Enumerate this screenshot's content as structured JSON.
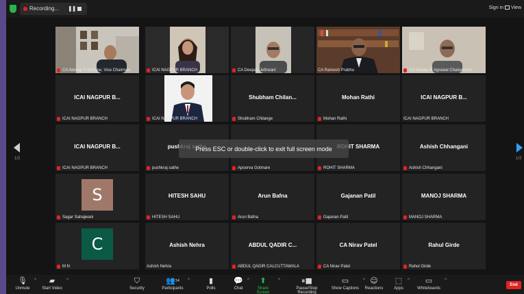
{
  "topbar": {
    "recording_label": "Recording...",
    "pause_glyph": "❚❚",
    "signin_label": "Sign in",
    "view_label": "View"
  },
  "nav": {
    "left_page": "1/2",
    "right_page": "1/2"
  },
  "toast": "Press ESC or double-click to exit full screen mode",
  "tiles": [
    {
      "center": "",
      "caption": "CA Akshay V Dzhane, Vice Chairman"
    },
    {
      "center": "",
      "caption": "ICAI NAGPUR BRANCH"
    },
    {
      "center": "",
      "caption": "CA Deepak Jethwani"
    },
    {
      "center": "",
      "caption": "CA Ramesh Prabhu"
    },
    {
      "center": "",
      "caption": "CA Sanjay M Agrawal Chairperson"
    },
    {
      "center": "ICAI NAGPUR B...",
      "caption": "ICAI NAGPUR BRANCH"
    },
    {
      "center": "",
      "caption": "ICAI NAGPUR BRANCH"
    },
    {
      "center": "Shubham Chilan...",
      "caption": "Shubham Chilange"
    },
    {
      "center": "Mohan Rathi",
      "caption": "Mohan Rathi"
    },
    {
      "center": "ICAI NAGPUR B...",
      "caption": "ICAI NAGPUR BRANCH"
    },
    {
      "center": "ICAI NAGPUR B...",
      "caption": "ICAI NAGPUR BRANCH"
    },
    {
      "center": "pushkraj sathe",
      "caption": "pushkraj sathe"
    },
    {
      "center": "",
      "caption": "Apoorva Gotmare"
    },
    {
      "center": "ROHIT SHARMA",
      "caption": "ROHIT SHARMA"
    },
    {
      "center": "Ashish Chhangani",
      "caption": "Ashish Chhangani"
    },
    {
      "center": "",
      "avatar": "S",
      "caption": "Sagar Sahajwani"
    },
    {
      "center": "HITESH SAHU",
      "caption": "HITESH SAHU"
    },
    {
      "center": "Arun Bafna",
      "caption": "Arun Bafna"
    },
    {
      "center": "Gajanan Patil",
      "caption": "Gajanan Patil"
    },
    {
      "center": "MANOJ SHARMA",
      "caption": "MANOJ SHARMA"
    },
    {
      "center": "",
      "avatar": "C",
      "caption": "M N"
    },
    {
      "center": "Ashish Nehra",
      "caption": "Ashish Nehra"
    },
    {
      "center": "ABDUL QADIR C...",
      "caption": "ABDUL QADIR CALCUTTAWALA"
    },
    {
      "center": "CA Nirav Patel",
      "caption": "CA Nirav Patel"
    },
    {
      "center": "Rahul Girde",
      "caption": "Rahul Girde"
    }
  ],
  "toolbar": {
    "unmute": "Unmute",
    "start_video": "Start Video",
    "security": "Security",
    "participants": "Participants",
    "participants_count": "34",
    "polls": "Polls",
    "chat": "Chat",
    "share_screen": "Share Screen",
    "pause_recording": "Pause/Stop Recording",
    "show_captions": "Show Captions",
    "reactions": "Reactions",
    "apps": "Apps",
    "whiteboards": "Whiteboards",
    "end": "End"
  },
  "colors": {
    "avatar_s": "#a0786a",
    "avatar_c": "#0b5a45",
    "active_speaker": "#b8e05a",
    "end_button": "#e02424",
    "share_green": "#27c24c"
  }
}
